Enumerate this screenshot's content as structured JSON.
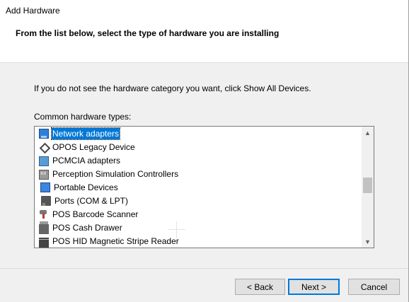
{
  "window": {
    "title": "Add Hardware"
  },
  "header": {
    "heading": "From the list below, select the type of hardware you are installing"
  },
  "body": {
    "instruction": "If you do not see the hardware category you want, click Show All Devices.",
    "list_label": "Common hardware types:"
  },
  "hardware_list": {
    "selected": "Network adapters",
    "items": [
      {
        "label": "Network adapters",
        "icon": "network-adapter-icon"
      },
      {
        "label": "OPOS Legacy Device",
        "icon": "opos-device-icon"
      },
      {
        "label": "PCMCIA adapters",
        "icon": "pcmcia-adapter-icon"
      },
      {
        "label": "Perception Simulation Controllers",
        "icon": "perception-controller-icon"
      },
      {
        "label": "Portable Devices",
        "icon": "portable-device-icon"
      },
      {
        "label": "Ports (COM & LPT)",
        "icon": "port-icon"
      },
      {
        "label": "POS Barcode Scanner",
        "icon": "barcode-scanner-icon"
      },
      {
        "label": "POS Cash Drawer",
        "icon": "cash-drawer-icon"
      },
      {
        "label": "POS HID Magnetic Stripe Reader",
        "icon": "magnetic-stripe-reader-icon"
      }
    ]
  },
  "buttons": {
    "back": "< Back",
    "next": "Next >",
    "cancel": "Cancel"
  },
  "colors": {
    "selection": "#0078d7",
    "default_button_border": "#0078d7"
  }
}
